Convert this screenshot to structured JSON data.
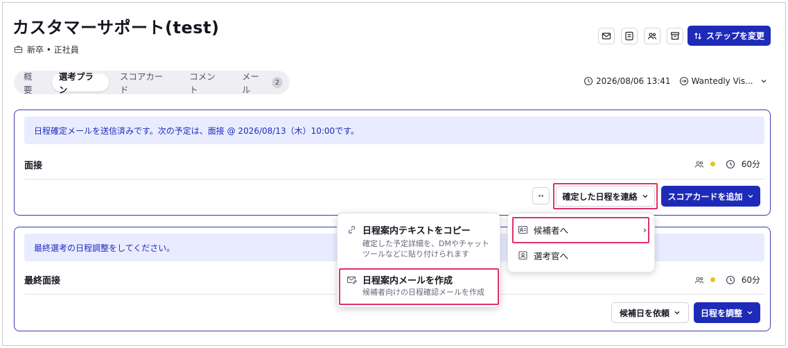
{
  "header": {
    "title": "カスタマーサポート(test)",
    "subtitle": "新卒 • 正社員",
    "step_button": "ステップを変更"
  },
  "tabs": [
    {
      "label": "概要"
    },
    {
      "label": "選考プラン",
      "active": true
    },
    {
      "label": "スコアカード"
    },
    {
      "label": "コメント"
    },
    {
      "label": "メール",
      "badge": "2"
    }
  ],
  "meta": {
    "datetime": "2026/08/06 13:41",
    "source": "Wantedly Vis..."
  },
  "cards": [
    {
      "banner": "日程確定メールを送信済みです。次の予定は、面接 @ 2026/08/13（木）10:00です。",
      "stage": "面接",
      "duration": "60分",
      "more_label": "··",
      "secondary_button": "確定した日程を連絡",
      "primary_button": "スコアカードを追加"
    },
    {
      "banner": "最終選考の日程調整をしてください。",
      "stage": "最終面接",
      "duration": "60分",
      "secondary_button": "候補日を依頼",
      "primary_button": "日程を調整"
    }
  ],
  "menu_left": {
    "items": [
      {
        "title": "日程案内テキストをコピー",
        "desc1": "確定した予定詳細を、DMやチャット",
        "desc2": "ツールなどに貼り付けられます"
      },
      {
        "title": "日程案内メールを作成",
        "desc1": "候補者向けの日程確認メールを作成"
      }
    ]
  },
  "menu_right": {
    "items": [
      {
        "label": "候補者へ",
        "chevron": "›"
      },
      {
        "label": "選考官へ"
      }
    ]
  },
  "colors": {
    "primary": "#1e2bb8",
    "banner_bg": "#e9ecff",
    "highlight": "#e0306a",
    "status_dot": "#e8c21e"
  }
}
